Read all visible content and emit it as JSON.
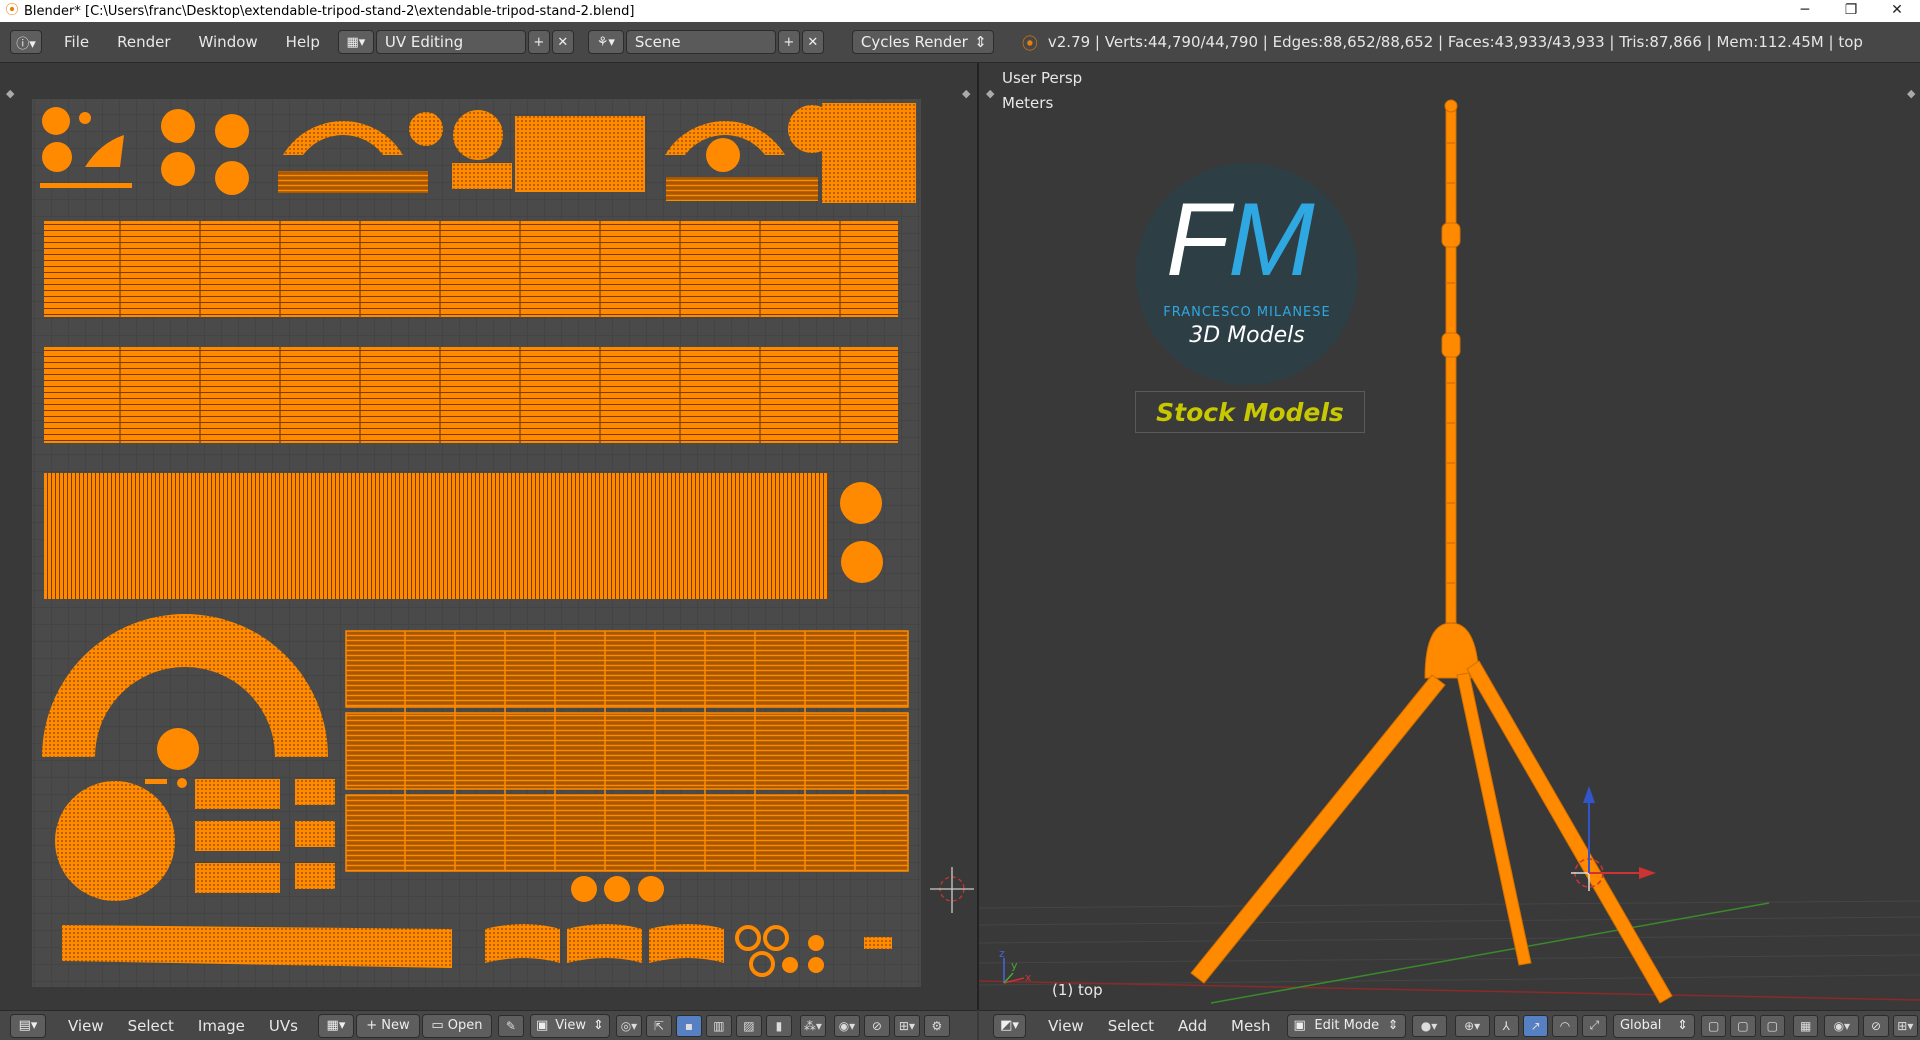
{
  "window": {
    "title": "Blender* [C:\\Users\\franc\\Desktop\\extendable-tripod-stand-2\\extendable-tripod-stand-2.blend]",
    "minimize": "─",
    "restore": "❐",
    "close": "✕"
  },
  "topbar": {
    "menus": [
      "File",
      "Render",
      "Window",
      "Help"
    ],
    "screen_layout": "UV Editing",
    "scene": "Scene",
    "render_engine": "Cycles Render",
    "stats": "v2.79 | Verts:44,790/44,790 | Edges:88,652/88,652 | Faces:43,933/43,933 | Tris:87,866 | Mem:112.45M | top"
  },
  "viewport": {
    "view_name": "User Persp",
    "units": "Meters",
    "object_label": "(1) top",
    "watermark": {
      "initials_f": "F",
      "initials_m": "M",
      "name": "FRANCESCO MILANESE",
      "sub": "3D Models",
      "tag": "Stock Models"
    },
    "axis_x": "x",
    "axis_y": "y",
    "axis_z": "z"
  },
  "uv_bottom": {
    "menus": [
      "View",
      "Select",
      "Image",
      "UVs"
    ],
    "new_label": "New",
    "open_label": "Open",
    "view_label": "View"
  },
  "view3d_bottom": {
    "menus": [
      "View",
      "Select",
      "Add",
      "Mesh"
    ],
    "mode": "Edit Mode",
    "orientation": "Global"
  },
  "colors": {
    "uv_orange": "#ff8a00",
    "header_bg": "#474747",
    "panel_bg": "#393939",
    "stock_yellow": "#c8c800",
    "fm_blue": "#2fa7e0"
  }
}
